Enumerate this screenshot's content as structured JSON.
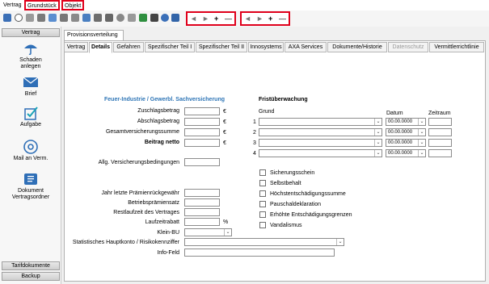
{
  "menubar": {
    "items": [
      "Vertrag",
      "Grundstück",
      "Objekt"
    ]
  },
  "pager_left": {
    "prev": "◄",
    "next": "►",
    "add": "+",
    "remove": "—"
  },
  "pager_right": {
    "prev": "◄",
    "next": "►",
    "add": "+",
    "remove": "—"
  },
  "toolbar_icons": [
    "save-icon",
    "cancel-icon",
    "list-icon",
    "tag-icon",
    "document-icon",
    "calendar-icon",
    "clipboard-icon",
    "home-icon",
    "house-icon",
    "camera-icon",
    "phone-icon",
    "settings-icon",
    "check-icon",
    "calculator-icon",
    "help-icon",
    "doc-blue-icon",
    "export-icon"
  ],
  "sidebar": {
    "header_top": "Vertrag",
    "actions": [
      {
        "label": "Schaden\nanlegen",
        "icon": "umbrella-icon"
      },
      {
        "label": "Brief",
        "icon": "envelope-icon"
      },
      {
        "label": "Aufgabe",
        "icon": "task-icon"
      },
      {
        "label": "Mail an Verm.",
        "icon": "at-icon"
      },
      {
        "label": "Dokument\nVertragsordner",
        "icon": "folder-document-icon"
      }
    ],
    "footer_buttons": [
      "Tarifdokumente",
      "Backup"
    ]
  },
  "panel": {
    "title": "Provisionsverteilung",
    "tabs": [
      "Vertrag",
      "Details",
      "Gefahren",
      "Spezifischer Teil I",
      "Spezifischer Teil II",
      "Innosystems",
      "AXA Services",
      "Dokumente/Historie",
      "Datenschutz",
      "Vermittlerrichtlinie"
    ],
    "active_tab": "Details",
    "disabled_tab": "Datenschutz"
  },
  "form": {
    "section_title": "Feuer-Industrie / Gewerbl. Sachversicherung",
    "zuschlag_label": "Zuschlagsbetrag",
    "abschlag_label": "Abschlagsbetrag",
    "gesamt_label": "Gesamtversicherungssumme",
    "beitrag_label": "Beitrag netto",
    "currency": "€",
    "avb_label": "Allg. Versicherungsbedingungen",
    "jahr_label": "Jahr letzte Prämienrückgewähr",
    "betrieb_label": "Betriebsprämiensatz",
    "restlauf_label": "Restlaufzeit des Vertrages",
    "laufzeit_label": "Laufzeitrabatt",
    "percent": "%",
    "klein_label": "Klein-BU",
    "stat_label": "Statistisches Hauptkonto / Risikokennziffer",
    "info_label": "Info-Feld"
  },
  "frist": {
    "title": "Fristüberwachung",
    "col_grund": "Grund",
    "col_datum": "Datum",
    "col_zeitraum": "Zeitraum",
    "rows": [
      {
        "num": "1",
        "date": "00.00.0000"
      },
      {
        "num": "2",
        "date": "00.00.0000"
      },
      {
        "num": "3",
        "date": "00.00.0000"
      },
      {
        "num": "4",
        "date": "00.00.0000"
      }
    ]
  },
  "checkboxes": [
    "Sicherungsschein",
    "Selbstbehalt",
    "Höchstentschädigungssumme",
    "Pauschaldeklaration",
    "Erhöhte Entschädigungsgrenzen",
    "Vandalismus"
  ],
  "colors": {
    "accent": "#2e75b6",
    "highlight": "#e0001b"
  }
}
